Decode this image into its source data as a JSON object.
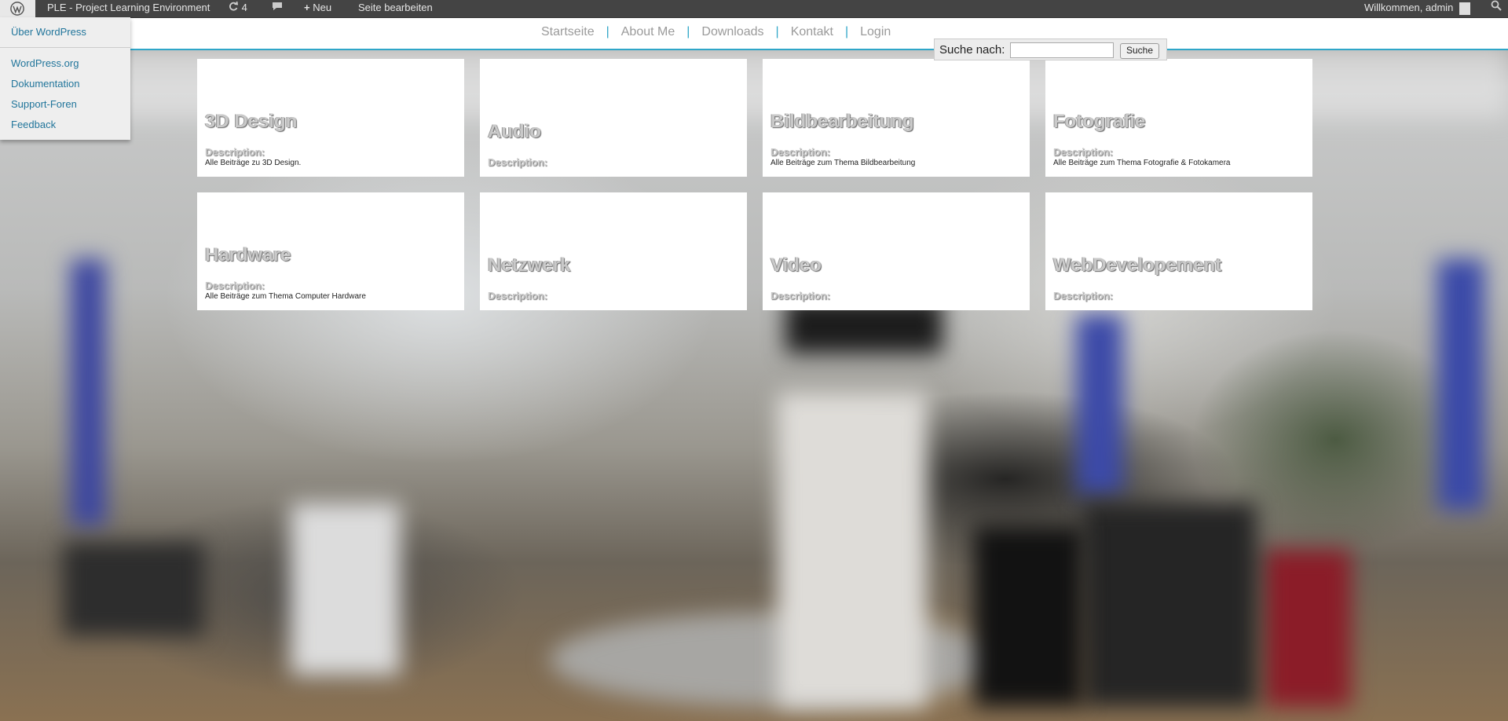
{
  "adminbar": {
    "site_name": "PLE - Project Learning Environment",
    "updates_count": "4",
    "new_label": "Neu",
    "edit_label": "Seite bearbeiten",
    "welcome": "Willkommen, admin"
  },
  "wp_menu": {
    "about": "Über WordPress",
    "links": [
      "WordPress.org",
      "Dokumentation",
      "Support-Foren",
      "Feedback"
    ]
  },
  "nav": [
    "Startseite",
    "About Me",
    "Downloads",
    "Kontakt",
    "Login"
  ],
  "search": {
    "label": "Suche nach:",
    "value": "",
    "button": "Suche"
  },
  "cards": [
    {
      "title": "3D Design",
      "desc_label": "Description:",
      "desc": "Alle Beiträge zu 3D Design."
    },
    {
      "title": "Audio",
      "desc_label": "Description:",
      "desc": ""
    },
    {
      "title": "Bildbearbeitung",
      "desc_label": "Description:",
      "desc": "Alle Beiträge zum Thema Bildbearbeitung"
    },
    {
      "title": "Fotografie",
      "desc_label": "Description:",
      "desc": "Alle Beiträge zum Thema Fotografie & Fotokamera"
    },
    {
      "title": "Hardware",
      "desc_label": "Description:",
      "desc": "Alle Beiträge zum Thema Computer Hardware"
    },
    {
      "title": "Netzwerk",
      "desc_label": "Description:",
      "desc": ""
    },
    {
      "title": "Video",
      "desc_label": "Description:",
      "desc": ""
    },
    {
      "title": "WebDevelopement",
      "desc_label": "Description:",
      "desc": ""
    }
  ]
}
